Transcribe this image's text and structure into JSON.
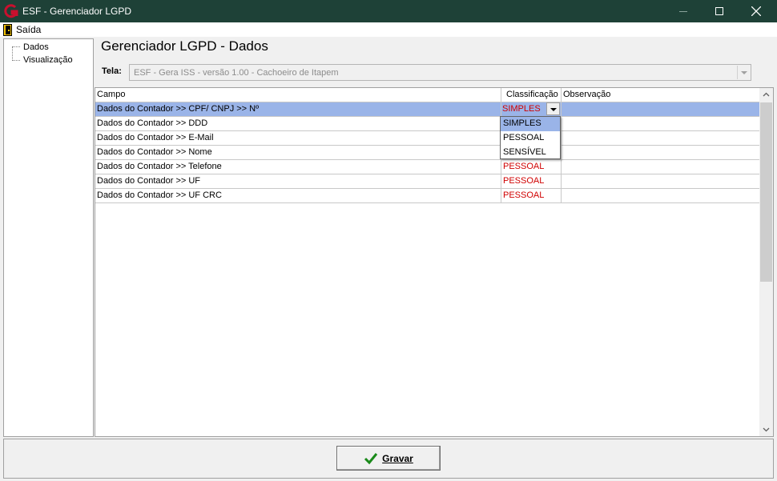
{
  "window": {
    "title": "ESF - Gerenciador LGPD",
    "brand_color": "#c8102e",
    "titlebar_color": "#1e4137"
  },
  "menu": {
    "saida_label": "Saída"
  },
  "sidebar": {
    "items": [
      {
        "label": "Dados"
      },
      {
        "label": "Visualização"
      }
    ]
  },
  "main": {
    "title": "Gerenciador LGPD - Dados",
    "tela_label": "Tela:",
    "tela_value": "ESF - Gera ISS - versão 1.00 - Cachoeiro de Itapem"
  },
  "grid": {
    "columns": [
      "Campo",
      "Classificação",
      "Observação"
    ],
    "rows": [
      {
        "campo": "Dados do Contador >> CPF/ CNPJ >> Nº",
        "classificacao": "SIMPLES",
        "observacao": ""
      },
      {
        "campo": "Dados do Contador >> DDD",
        "classificacao": "",
        "observacao": ""
      },
      {
        "campo": "Dados do Contador >> E-Mail",
        "classificacao": "",
        "observacao": ""
      },
      {
        "campo": "Dados do Contador >> Nome",
        "classificacao": "",
        "observacao": ""
      },
      {
        "campo": "Dados do Contador >> Telefone",
        "classificacao": "PESSOAL",
        "observacao": ""
      },
      {
        "campo": "Dados do Contador >> UF",
        "classificacao": "PESSOAL",
        "observacao": ""
      },
      {
        "campo": "Dados do Contador >> UF CRC",
        "classificacao": "PESSOAL",
        "observacao": ""
      }
    ],
    "selected_color": "#9ab4e8",
    "classification_color": "#d00000"
  },
  "dropdown": {
    "options": [
      "SIMPLES",
      "PESSOAL",
      "SENSÍVEL"
    ],
    "highlighted": "SIMPLES"
  },
  "footer": {
    "gravar_label": "Gravar"
  }
}
